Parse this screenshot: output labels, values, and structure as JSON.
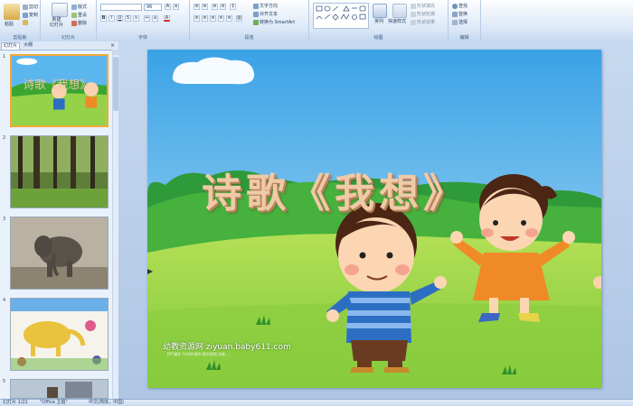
{
  "ribbon": {
    "clipboard": {
      "paste": "粘贴",
      "cut": "剪切",
      "copy": "复制",
      "format_painter": "格式刷",
      "label": "剪贴板"
    },
    "slides": {
      "new_slide": "新建\n幻灯片",
      "layout": "版式",
      "reset": "重设",
      "delete": "删除",
      "label": "幻灯片"
    },
    "font": {
      "font_size": "96",
      "label": "字体"
    },
    "paragraph": {
      "text_direction": "文字方向",
      "align_text": "对齐文本",
      "convert_smartart": "转换为 SmartArt",
      "label": "段落"
    },
    "drawing": {
      "arrange": "排列",
      "quick_styles": "快速样式",
      "shape_fill": "形状填充",
      "shape_outline": "形状轮廓",
      "shape_effects": "形状效果",
      "label": "绘图"
    },
    "editing": {
      "find": "查找",
      "replace": "替换",
      "select": "选择",
      "label": "编辑"
    }
  },
  "pane": {
    "tab_slides": "幻灯片",
    "tab_outline": "大纲",
    "slide_numbers": [
      "1",
      "2",
      "3",
      "4",
      "5"
    ]
  },
  "slide": {
    "title": "诗歌《我想》",
    "watermark": "幼教资源网 ziyuan.baby611.com",
    "watermark_sub": "PPT课件 FLASH课件 教学视频 试卷 ..."
  },
  "status": {
    "slide_counter": "幻灯片 1/22",
    "theme": "\"Office 主题\"",
    "language": "中文(简体，中国)"
  },
  "colors": {
    "sky_top": "#3aa2e6",
    "grass": "#8fd040",
    "title": "#f0c9a6",
    "accent_selection": "#f2a93b"
  }
}
